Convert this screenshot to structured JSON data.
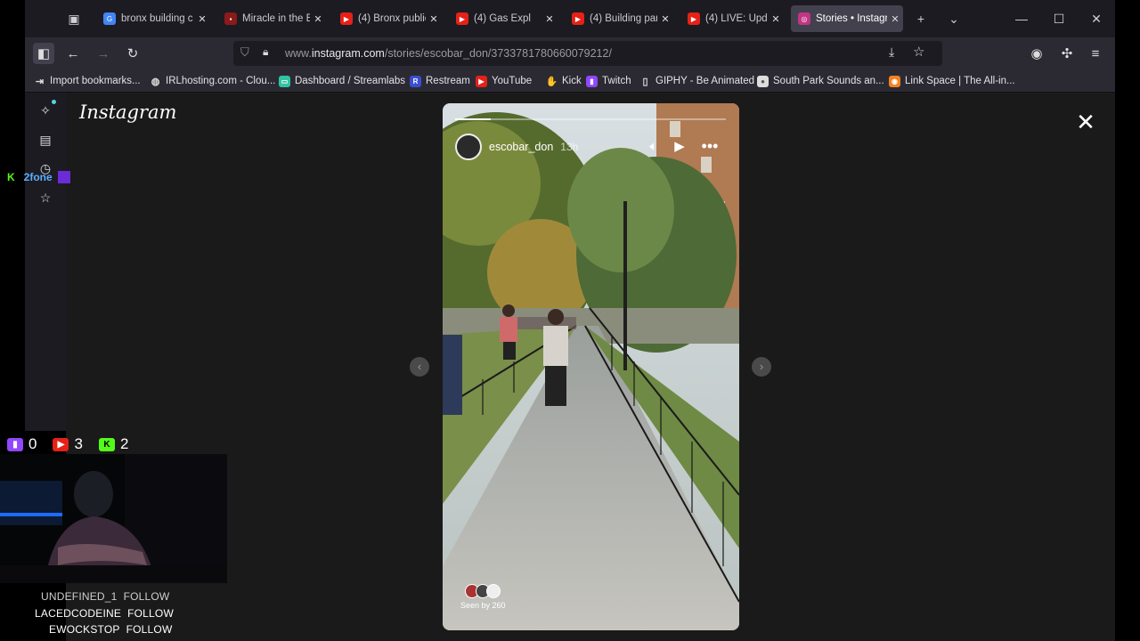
{
  "tabs": [
    {
      "title": "bronx building c",
      "favicon": "google-icon",
      "color": "#4285f4",
      "active": false
    },
    {
      "title": "Miracle in the B",
      "favicon": "news-icon",
      "color": "#8b1a1a",
      "active": false
    },
    {
      "title": "(4) Bronx public",
      "favicon": "youtube-icon",
      "color": "#e62117",
      "active": false
    },
    {
      "title": "(4) Gas Expl",
      "favicon": "youtube-icon",
      "color": "#e62117",
      "active": false
    },
    {
      "title": "(4) Building par",
      "favicon": "youtube-icon",
      "color": "#e62117",
      "active": false
    },
    {
      "title": "(4) LIVE: Update",
      "favicon": "youtube-icon",
      "color": "#e62117",
      "active": false
    },
    {
      "title": "Stories • Instagr",
      "favicon": "instagram-icon",
      "color": "#c13584",
      "active": true
    }
  ],
  "url": {
    "prefix": "www.",
    "domain": "instagram.com",
    "path": "/stories/escobar_don/3733781780660079212/"
  },
  "bookmarks": [
    {
      "label": "Import bookmarks...",
      "icon": "import-icon",
      "color": "#2b2a33",
      "glyph": "⇥"
    },
    {
      "label": "IRLhosting.com - Clou...",
      "icon": "globe-icon",
      "color": "#2b2a33",
      "glyph": "◍"
    },
    {
      "label": "Dashboard / Streamlabs",
      "icon": "streamlabs-icon",
      "color": "#31c3a2",
      "glyph": "▭"
    },
    {
      "label": "Restream",
      "icon": "restream-icon",
      "color": "#3a4ed5",
      "glyph": "R"
    },
    {
      "label": "YouTube",
      "icon": "youtube-icon",
      "color": "#e62117",
      "glyph": "▶"
    },
    {
      "label": "Kick",
      "icon": "kick-icon",
      "color": "#2b2a33",
      "glyph": "✋"
    },
    {
      "label": "Twitch",
      "icon": "twitch-icon",
      "color": "#9146ff",
      "glyph": "▮"
    },
    {
      "label": "GIPHY - Be Animated",
      "icon": "giphy-icon",
      "color": "#2b2a33",
      "glyph": "▯"
    },
    {
      "label": "South Park Sounds an...",
      "icon": "southpark-icon",
      "color": "#ddd",
      "glyph": "●"
    },
    {
      "label": "Link Space | The All-in...",
      "icon": "linkspace-icon",
      "color": "#f5821f",
      "glyph": "◉"
    }
  ],
  "instagram": {
    "logo": "Instagram"
  },
  "story": {
    "username": "escobar_don",
    "age": "13h",
    "progress_fraction": 0.13,
    "seen_by": "Seen by 260"
  },
  "overlay": {
    "twitch_count": "0",
    "youtube_count": "3",
    "kick_count": "2",
    "sticker_text": "2fone",
    "followers": [
      {
        "name": "UNDEFINED_1",
        "action": "FOLLOW"
      },
      {
        "name": "LACEDCODEINE",
        "action": "FOLLOW"
      },
      {
        "name": "EWOCKSTOP",
        "action": "FOLLOW"
      }
    ]
  },
  "colors": {
    "accent_twitch": "#9146ff",
    "accent_youtube": "#e62117",
    "accent_kick": "#53fc18"
  }
}
